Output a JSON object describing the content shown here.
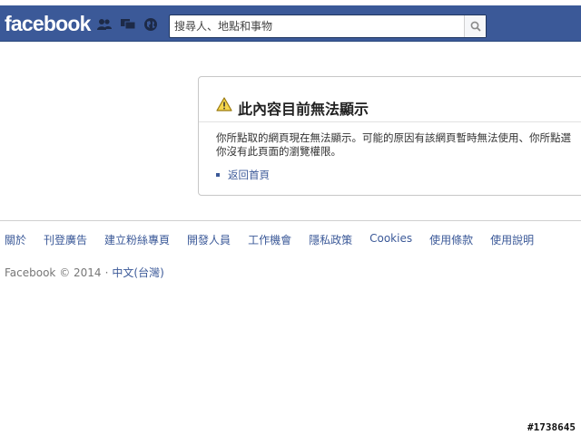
{
  "header": {
    "logo": "facebook",
    "search_placeholder": "搜尋人、地點和事物",
    "icons": [
      "friend-requests-icon",
      "messages-icon",
      "notifications-globe-icon",
      "search-icon"
    ],
    "brand_color": "#3b5998"
  },
  "error_card": {
    "title": "此內容目前無法顯示",
    "body_line1": "你所點取的網頁現在無法顯示。可能的原因有該網頁暫時無法使用、你所點選",
    "body_line2": "你沒有此頁面的瀏覽權限。",
    "link": "返回首頁",
    "icon": "warning-icon"
  },
  "footer": {
    "links": [
      "關於",
      "刊登廣告",
      "建立粉絲專頁",
      "開發人員",
      "工作機會",
      "隱私政策",
      "Cookies",
      "使用條款",
      "使用說明"
    ],
    "copyright": "Facebook © 2014",
    "separator": "·",
    "language": "中文(台灣)"
  },
  "watermark": "#1738645"
}
